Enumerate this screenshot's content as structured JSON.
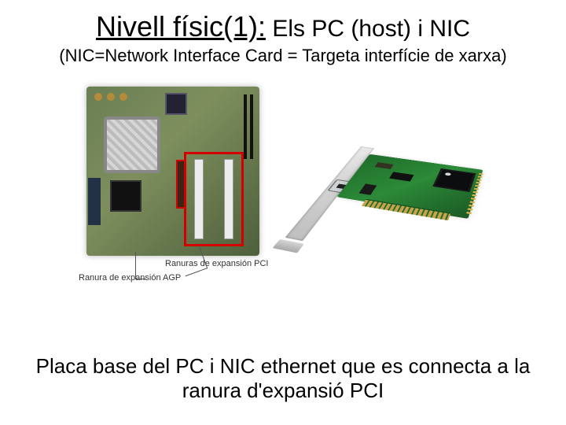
{
  "title": {
    "main": "Nivell físic(1):",
    "sub": "Els PC  (host) i NIC"
  },
  "subtitle": "(NIC=Network Interface Card = Targeta interfície de xarxa)",
  "images": {
    "left": {
      "alt": "motherboard-photo",
      "callout_pci": "Ranuras de expansión PCI",
      "callout_agp": "Ranura de expansión AGP"
    },
    "right": {
      "alt": "nic-card-photo"
    }
  },
  "caption": "Placa base del PC i NIC  ethernet que es connecta a la ranura d'expansió PCI"
}
